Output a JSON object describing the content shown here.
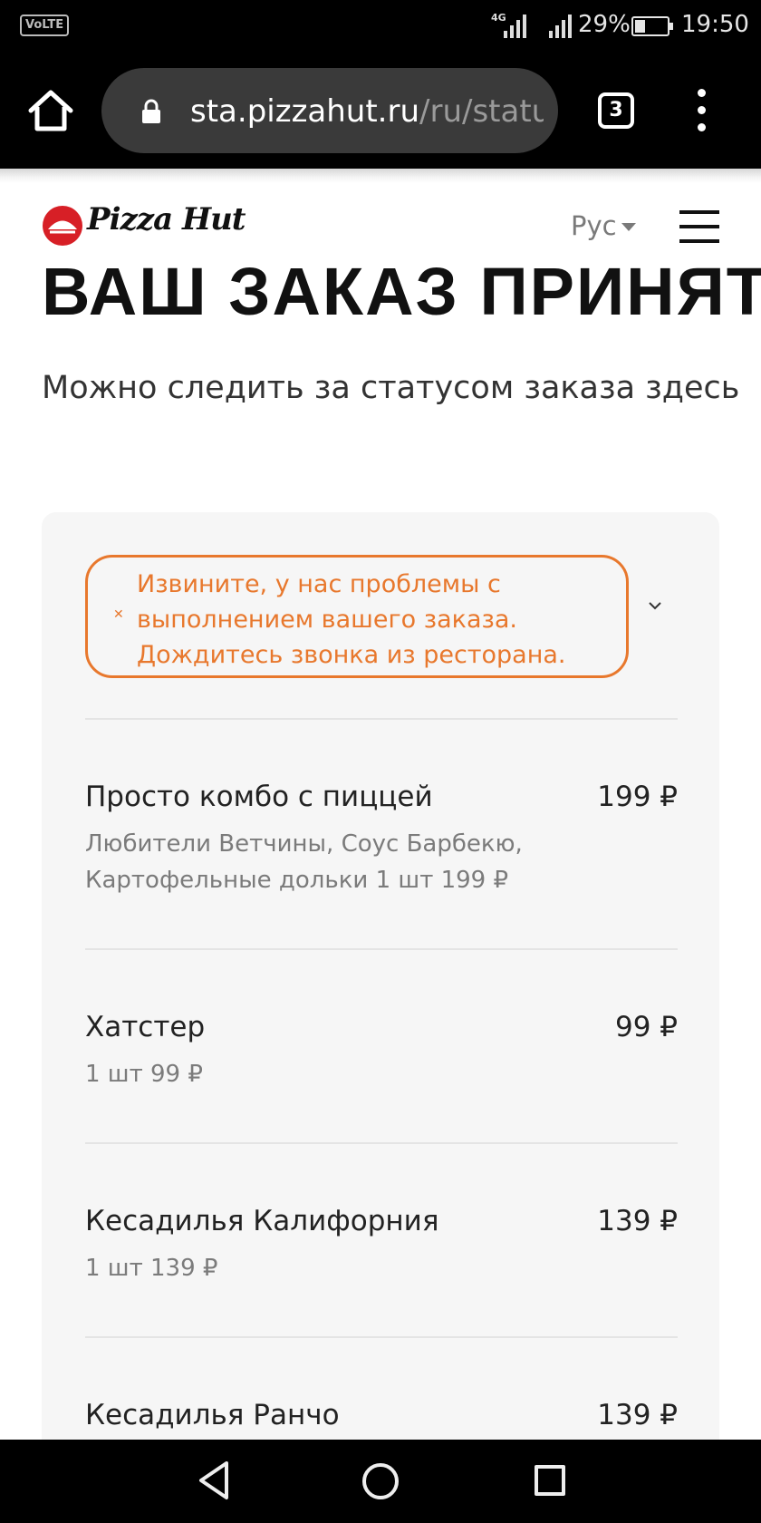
{
  "status_bar": {
    "volte": "VoLTE",
    "network": "4G",
    "battery_percent": "29%",
    "time": "19:50"
  },
  "browser": {
    "url_host": "sta.pizzahut.ru",
    "url_path": "/ru/status",
    "tab_count": "3"
  },
  "header": {
    "logo_text": "Pizza Hut",
    "language": "Рус"
  },
  "page": {
    "title": "ВАШ ЗАКАЗ ПРИНЯТ",
    "subtitle": "Можно следить за статусом заказа здесь"
  },
  "alert": {
    "text": "Извините, у нас проблемы с выполнением вашего заказа. Дождитесь звонка из ресторана.",
    "color": "#e8782d"
  },
  "order_items": [
    {
      "name": "Просто комбо с пиццей",
      "price": "199 ₽",
      "detail": "Любители Ветчины, Соус Барбекю, Картофельные дольки 1 шт 199 ₽"
    },
    {
      "name": "Хатстер",
      "price": "99 ₽",
      "detail": "1 шт 99 ₽"
    },
    {
      "name": "Кесадилья Калифорния",
      "price": "139 ₽",
      "detail": "1 шт 139 ₽"
    },
    {
      "name": "Кесадилья Ранчо",
      "price": "139 ₽",
      "detail": ""
    }
  ],
  "icons": {
    "home": "home-icon",
    "lock": "lock-icon",
    "tabs": "tabs-icon",
    "menu": "more-vert-icon",
    "hamburger": "hamburger-menu-icon",
    "expand": "chevron-down-icon",
    "close": "close-icon",
    "nav_back": "back-triangle-icon",
    "nav_home": "home-circle-icon",
    "nav_recent": "recents-square-icon"
  }
}
